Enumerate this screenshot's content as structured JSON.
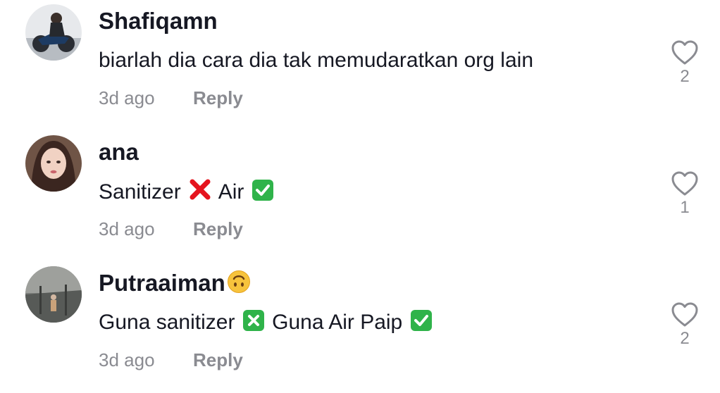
{
  "colors": {
    "username": "#161823",
    "text": "#161823",
    "meta": "#8a8b91",
    "heart_outline": "#8a8b91",
    "cross_red": "#e5141e",
    "check_green": "#2fb34a"
  },
  "comments": [
    {
      "username": "Shafiqamn",
      "text": "biarlah dia cara dia tak memudaratkan org lain",
      "timestamp": "3d ago",
      "reply_label": "Reply",
      "likes": "2",
      "avatar_icon": "user-avatar-motorbike-photo"
    },
    {
      "username": "ana",
      "text_parts": [
        "Sanitizer",
        "Air"
      ],
      "timestamp": "3d ago",
      "reply_label": "Reply",
      "likes": "1",
      "avatar_icon": "user-avatar-portrait-photo"
    },
    {
      "username": "Putraaiman",
      "text_parts": [
        "Guna sanitizer",
        "Guna Air Paip"
      ],
      "timestamp": "3d ago",
      "reply_label": "Reply",
      "likes": "2",
      "avatar_icon": "user-avatar-street-photo"
    }
  ],
  "icons": {
    "like": "heart-outline-icon",
    "cross": "cross-mark-emoji",
    "check": "check-mark-button-emoji",
    "upside_down": "upside-down-face-emoji",
    "green_cross": "cross-mark-button-emoji"
  }
}
